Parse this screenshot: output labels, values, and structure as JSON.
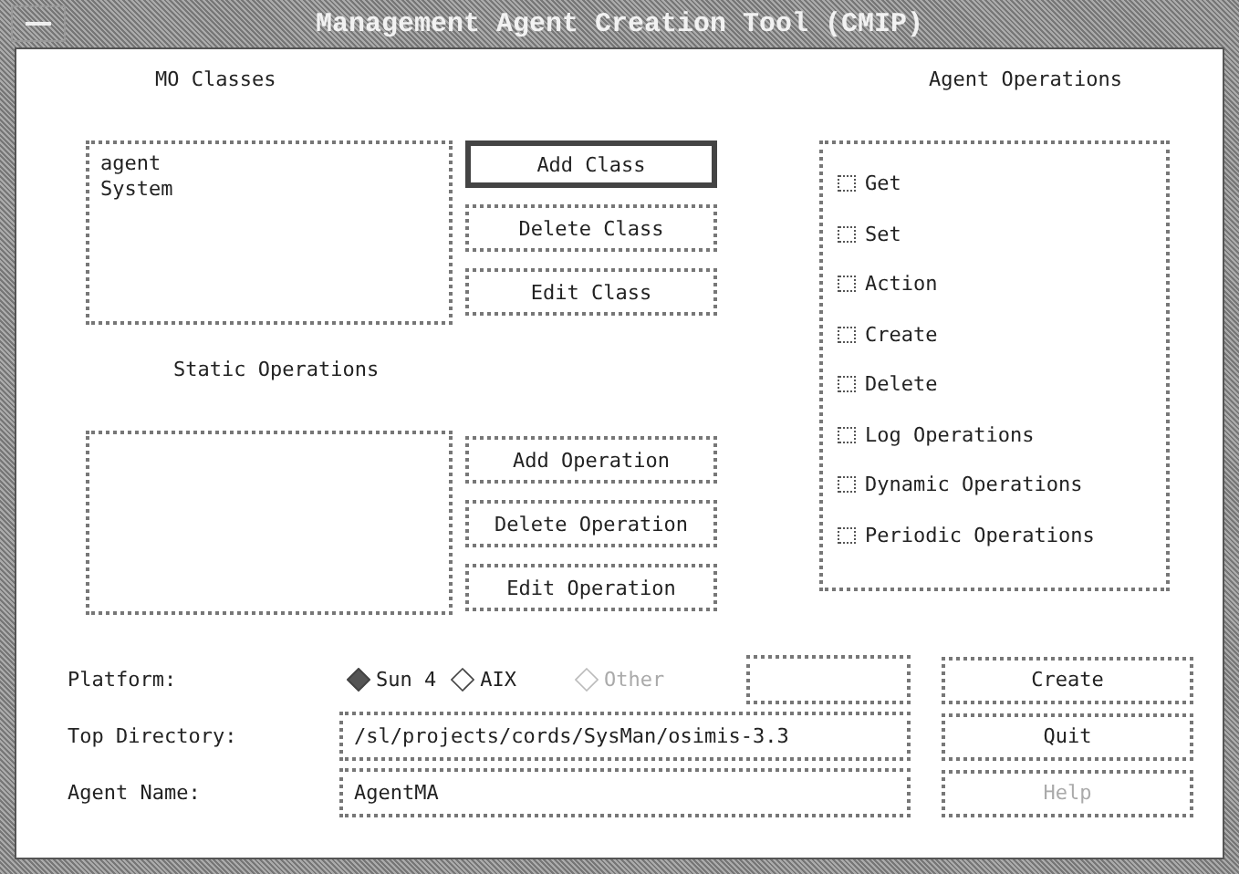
{
  "window": {
    "title": "Management Agent Creation Tool (CMIP)"
  },
  "mo_classes": {
    "label": "MO Classes",
    "items": [
      "agent",
      "System"
    ]
  },
  "class_buttons": [
    {
      "label": "Add Class",
      "default": true
    },
    {
      "label": "Delete Class",
      "default": false
    },
    {
      "label": "Edit Class",
      "default": false
    }
  ],
  "static_operations": {
    "label": "Static Operations"
  },
  "operation_buttons": [
    {
      "label": "Add Operation",
      "default": false
    },
    {
      "label": "Delete Operation",
      "default": false
    },
    {
      "label": "Edit Operation",
      "default": false
    }
  ],
  "agent_operations": {
    "label": "Agent Operations",
    "items": [
      {
        "label": "Get",
        "checked": false
      },
      {
        "label": "Set",
        "checked": false
      },
      {
        "label": "Action",
        "checked": false
      },
      {
        "label": "Create",
        "checked": false
      },
      {
        "label": "Delete",
        "checked": false
      },
      {
        "label": "Log Operations",
        "checked": false
      },
      {
        "label": "Dynamic Operations",
        "checked": false
      },
      {
        "label": "Periodic Operations",
        "checked": false
      }
    ]
  },
  "platform": {
    "label": "Platform:",
    "options": [
      {
        "label": "Sun 4",
        "selected": true,
        "disabled": false
      },
      {
        "label": "AIX",
        "selected": false,
        "disabled": false
      },
      {
        "label": "Other",
        "selected": false,
        "disabled": true
      }
    ]
  },
  "top_directory": {
    "label": "Top Directory:",
    "value": "/sl/projects/cords/SysMan/osimis-3.3"
  },
  "agent_name": {
    "label": "Agent Name:",
    "value": "AgentMA"
  },
  "actions": [
    {
      "label": "Create",
      "disabled": false
    },
    {
      "label": "Quit",
      "disabled": false
    },
    {
      "label": "Help",
      "disabled": true
    }
  ]
}
